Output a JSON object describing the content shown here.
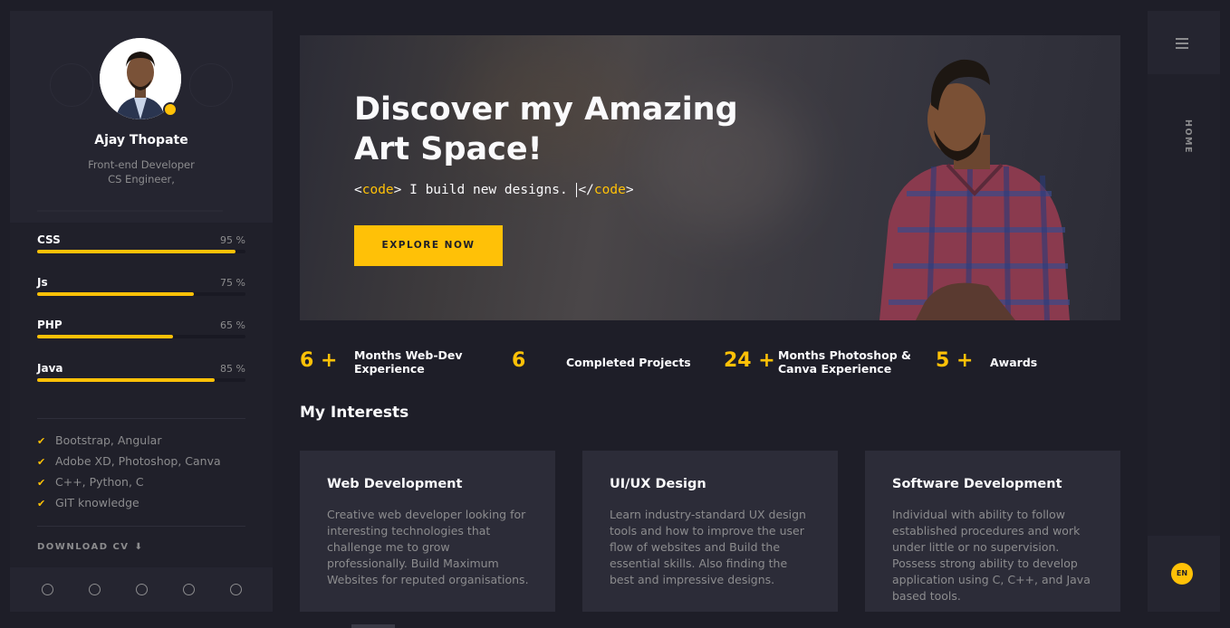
{
  "profile": {
    "name": "Ajay Thopate",
    "role_line1": "Front-end Developer",
    "role_line2": "CS Engineer,"
  },
  "skills": [
    {
      "name": "CSS",
      "percent_label": "95 %",
      "value": 95
    },
    {
      "name": "Js",
      "percent_label": "75 %",
      "value": 75
    },
    {
      "name": "PHP",
      "percent_label": "65 %",
      "value": 65
    },
    {
      "name": "Java",
      "percent_label": "85 %",
      "value": 85
    }
  ],
  "knowledge": [
    "Bootstrap, Angular",
    "Adobe XD, Photoshop, Canva",
    "C++, Python, C",
    "GIT knowledge"
  ],
  "download_label": "DOWNLOAD CV",
  "hero": {
    "title_line1": "Discover my Amazing",
    "title_line2": "Art Space!",
    "code_open": "<",
    "code_tag": "code",
    "code_close": ">",
    "code_text": " I build new designs. ",
    "code_end_open": "</",
    "code_end_tag": "code",
    "code_end_close": ">",
    "button_label": "EXPLORE NOW"
  },
  "stats": [
    {
      "number": "6 +",
      "label_line1": "Months Web-Dev",
      "label_line2": "Experience"
    },
    {
      "number": "6",
      "label_line1": "Completed Projects",
      "label_line2": ""
    },
    {
      "number": "24 +",
      "label_line1": "Months Photoshop &",
      "label_line2": "Canva Experience"
    },
    {
      "number": "5 +",
      "label_line1": "Awards",
      "label_line2": ""
    }
  ],
  "interests": {
    "title": "My Interests",
    "cards": [
      {
        "title": "Web Development",
        "text": "Creative web developer looking for interesting technologies that challenge me to grow professionally. Build Maximum Websites for reputed organisations."
      },
      {
        "title": "UI/UX Design",
        "text": "Learn industry-standard UX design tools and how to improve the user flow of websites and Build the essential skills. Also finding the best and impressive designs."
      },
      {
        "title": "Software Development",
        "text": "Individual with ability to follow established procedures and work under little or no supervision. Possess strong ability to develop application using C, C++, and Java based tools."
      }
    ]
  },
  "rail": {
    "home_label": "HOME",
    "lang_label": "EN"
  },
  "colors": {
    "accent": "#ffc107",
    "background": "#1e1e28",
    "panel": "#20202a",
    "card": "#2c2c38",
    "muted_text": "#8c8c8e"
  }
}
